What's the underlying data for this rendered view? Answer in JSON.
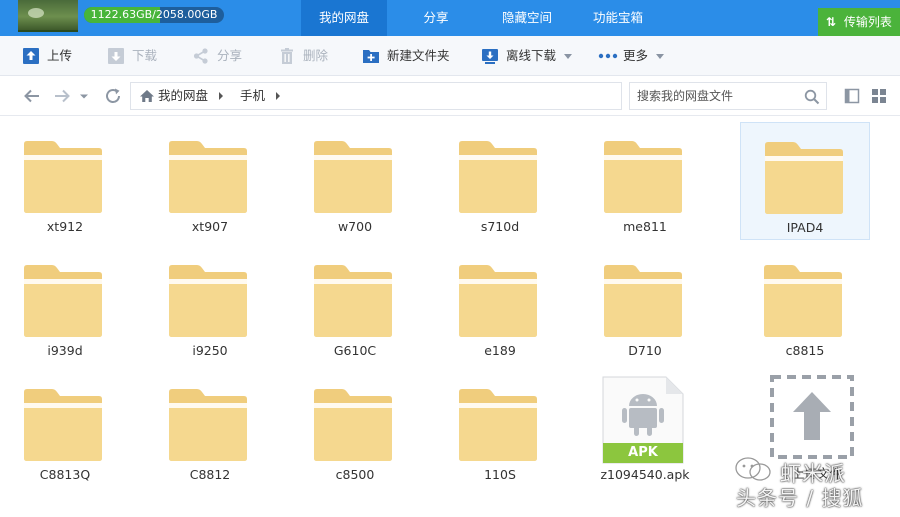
{
  "header": {
    "quota_text": "1122.63GB/2058.00GB",
    "quota_used_fraction": 0.545,
    "tabs": [
      {
        "label": "我的网盘",
        "active": true
      },
      {
        "label": "分享",
        "active": false
      },
      {
        "label": "隐藏空间",
        "active": false
      },
      {
        "label": "功能宝箱",
        "active": false
      }
    ],
    "transfer_label": "传输列表"
  },
  "toolbar": {
    "upload": "上传",
    "download": "下载",
    "share": "分享",
    "delete": "删除",
    "new_folder": "新建文件夹",
    "offline_download": "离线下载",
    "more": "更多"
  },
  "breadcrumb": {
    "root": "我的网盘",
    "current": "手机"
  },
  "search": {
    "placeholder": "搜索我的网盘文件"
  },
  "files": [
    {
      "name": "xt912",
      "type": "folder"
    },
    {
      "name": "xt907",
      "type": "folder"
    },
    {
      "name": "w700",
      "type": "folder"
    },
    {
      "name": "s710d",
      "type": "folder"
    },
    {
      "name": "me811",
      "type": "folder"
    },
    {
      "name": "IPAD4",
      "type": "folder",
      "selected": true
    },
    {
      "name": "i939d",
      "type": "folder"
    },
    {
      "name": "i9250",
      "type": "folder"
    },
    {
      "name": "G610C",
      "type": "folder"
    },
    {
      "name": "e189",
      "type": "folder"
    },
    {
      "name": "D710",
      "type": "folder"
    },
    {
      "name": "c8815",
      "type": "folder"
    },
    {
      "name": "C8813Q",
      "type": "folder"
    },
    {
      "name": "C8812",
      "type": "folder"
    },
    {
      "name": "c8500",
      "type": "folder"
    },
    {
      "name": "110S",
      "type": "folder"
    },
    {
      "name": "z1094540.apk",
      "type": "apk",
      "badge": "APK"
    },
    {
      "name": "上传文件",
      "type": "upload"
    }
  ],
  "watermark": {
    "line1": "虾米派",
    "line2": "头条号 / 搜狐"
  },
  "colors": {
    "header_bg": "#2b8de8",
    "active_tab": "#1a76d2",
    "transfer_btn": "#4bb33b",
    "folder": "#f5d58f",
    "apk_green": "#8cc63e"
  }
}
